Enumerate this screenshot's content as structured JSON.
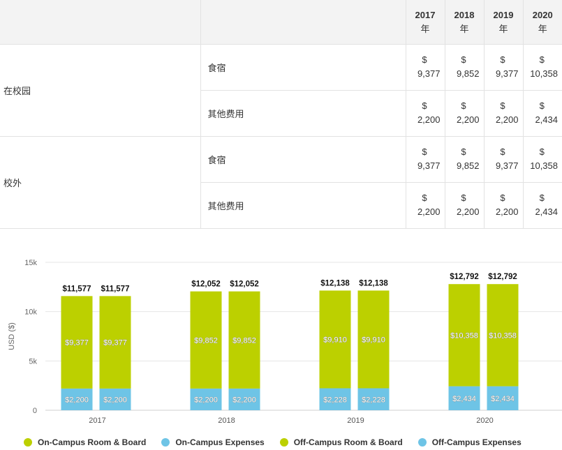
{
  "table": {
    "years": [
      {
        "year": "2017",
        "suffix": "年"
      },
      {
        "year": "2018",
        "suffix": "年"
      },
      {
        "year": "2019",
        "suffix": "年"
      },
      {
        "year": "2020",
        "suffix": "年"
      }
    ],
    "groups": [
      {
        "label": "在校园",
        "rows": [
          {
            "label": "食宿",
            "values": [
              "9,377",
              "9,852",
              "9,377",
              "10,358"
            ]
          },
          {
            "label": "其他费用",
            "values": [
              "2,200",
              "2,200",
              "2,200",
              "2,434"
            ]
          }
        ]
      },
      {
        "label": "校外",
        "rows": [
          {
            "label": "食宿",
            "values": [
              "9,377",
              "9,852",
              "9,377",
              "10,358"
            ]
          },
          {
            "label": "其他费用",
            "values": [
              "2,200",
              "2,200",
              "2,200",
              "2,434"
            ]
          }
        ]
      }
    ],
    "currency_symbol": "$"
  },
  "chart_data": {
    "type": "bar",
    "stacked": true,
    "categories": [
      "2017",
      "2018",
      "2019",
      "2020"
    ],
    "ylabel": "USD ($)",
    "ylim": [
      0,
      15000
    ],
    "yticks": [
      0,
      5000,
      10000,
      15000
    ],
    "ytick_labels": [
      "0",
      "5k",
      "10k",
      "15k"
    ],
    "grid": true,
    "legend_position": "bottom",
    "stacks": [
      {
        "name": "On-Campus",
        "series": [
          {
            "name": "On-Campus Expenses",
            "color": "#6ec4e6",
            "values": [
              2200,
              2200,
              2228,
              2434
            ]
          },
          {
            "name": "On-Campus Room & Board",
            "color": "#bcd000",
            "values": [
              9377,
              9852,
              9910,
              10358
            ]
          }
        ],
        "totals": [
          11577,
          12052,
          12138,
          12792
        ]
      },
      {
        "name": "Off-Campus",
        "series": [
          {
            "name": "Off-Campus Expenses",
            "color": "#6ec4e6",
            "values": [
              2200,
              2200,
              2228,
              2434
            ]
          },
          {
            "name": "Off-Campus Room & Board",
            "color": "#bcd000",
            "values": [
              9377,
              9852,
              9910,
              10358
            ]
          }
        ],
        "totals": [
          11577,
          12052,
          12138,
          12792
        ]
      }
    ],
    "legend": [
      {
        "label": "On-Campus Room & Board",
        "color": "#bcd000"
      },
      {
        "label": "On-Campus Expenses",
        "color": "#6ec4e6"
      },
      {
        "label": "Off-Campus Room & Board",
        "color": "#bcd000"
      },
      {
        "label": "Off-Campus Expenses",
        "color": "#6ec4e6"
      }
    ]
  }
}
